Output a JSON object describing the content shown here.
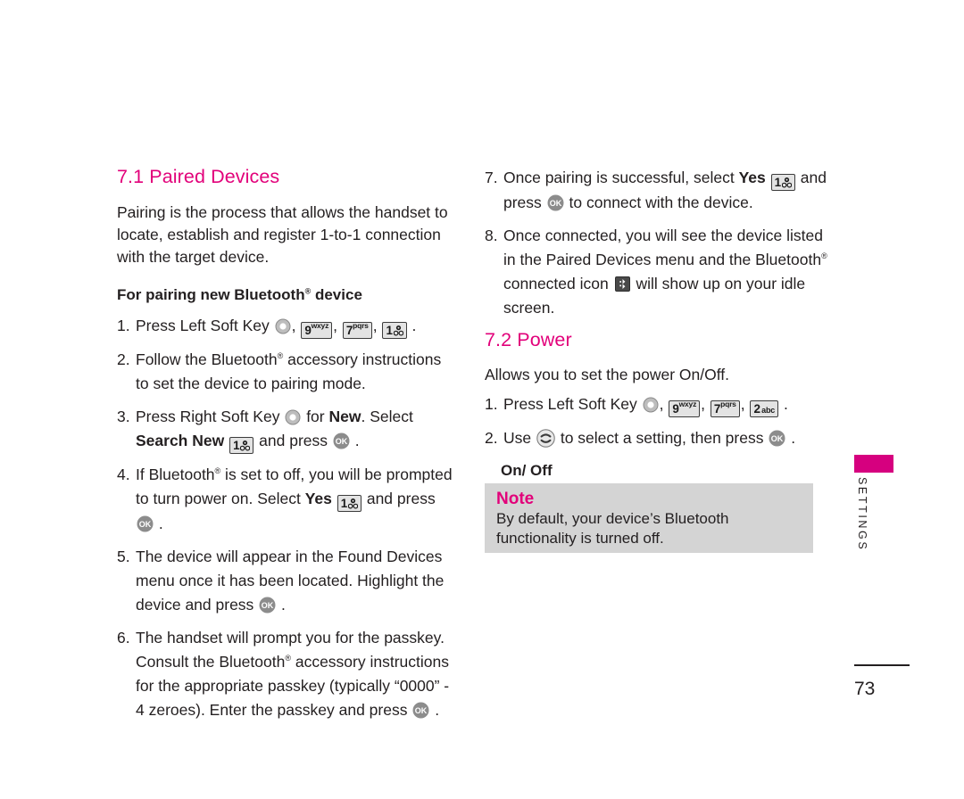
{
  "document": {
    "page_number": "73",
    "side_tab_label": "SETTINGS",
    "accent_color": "#e2007a",
    "tab_color": "#d6007f"
  },
  "left_column": {
    "heading": "7.1 Paired Devices",
    "intro": "Pairing is the process that allows the handset to locate, establish and register 1-to-1 connection with the target device.",
    "subheading_prefix": "For pairing new Bluetooth",
    "subheading_suffix": " device",
    "steps": [
      {
        "num": "1.",
        "t1": "Press Left Soft Key ",
        "t2": ", ",
        "t3": ", ",
        "t4": ", ",
        "t5": " ."
      },
      {
        "num": "2.",
        "t1": "Follow the Bluetooth",
        "t2": " accessory instructions to set the device to pairing mode."
      },
      {
        "num": "3.",
        "t1": "Press Right Soft Key ",
        "t2": " for ",
        "bold1": "New",
        "t3": ". Select ",
        "bold2": "Search New",
        "t4": " ",
        "t5": " and press ",
        "t6": " ."
      },
      {
        "num": "4.",
        "t1": "If Bluetooth",
        "t2": " is set to off, you will be prompted to turn power on. Select ",
        "bold1": "Yes",
        "t3": " ",
        "t4": " and press ",
        "t5": " ."
      },
      {
        "num": "5.",
        "t1": "The device will appear in the Found Devices menu once it has been located. Highlight the device and press ",
        "t2": " ."
      },
      {
        "num": "6.",
        "t1": "The handset will prompt you for the passkey. Consult the Bluetooth",
        "t2": " accessory instructions for the appropriate passkey (typically “0000” - 4 zeroes). Enter the passkey and press ",
        "t3": " ."
      }
    ]
  },
  "right_column": {
    "steps": [
      {
        "num": "7.",
        "t1": "Once pairing is successful, select ",
        "bold1": "Yes",
        "t2": " ",
        "t3": " and press ",
        "t4": " to connect with the device."
      },
      {
        "num": "8.",
        "t1": "Once connected, you will see the device listed in the Paired Devices menu and the Bluetooth",
        "t2": " connected icon ",
        "t3": " will show up on your idle screen."
      }
    ],
    "heading": "7.2 Power",
    "intro": "Allows you to set the power On/Off.",
    "power_steps": [
      {
        "num": "1.",
        "t1": "Press Left Soft Key ",
        "t2": ", ",
        "t3": ", ",
        "t4": ", ",
        "t5": " ."
      },
      {
        "num": "2.",
        "t1": "Use ",
        "t2": " to select a setting, then press ",
        "t3": " ."
      }
    ],
    "options": "On/ Off"
  },
  "note": {
    "title": "Note",
    "body": "By default, your device’s Bluetooth functionality is turned off."
  },
  "keys": {
    "nine": {
      "digit": "9",
      "letters": "wxyz"
    },
    "seven": {
      "digit": "7",
      "letters": "pqrs"
    },
    "one": {
      "digit": "1",
      "letters": ""
    },
    "two": {
      "digit": "2",
      "letters": "abc"
    },
    "ok_label": "OK"
  }
}
